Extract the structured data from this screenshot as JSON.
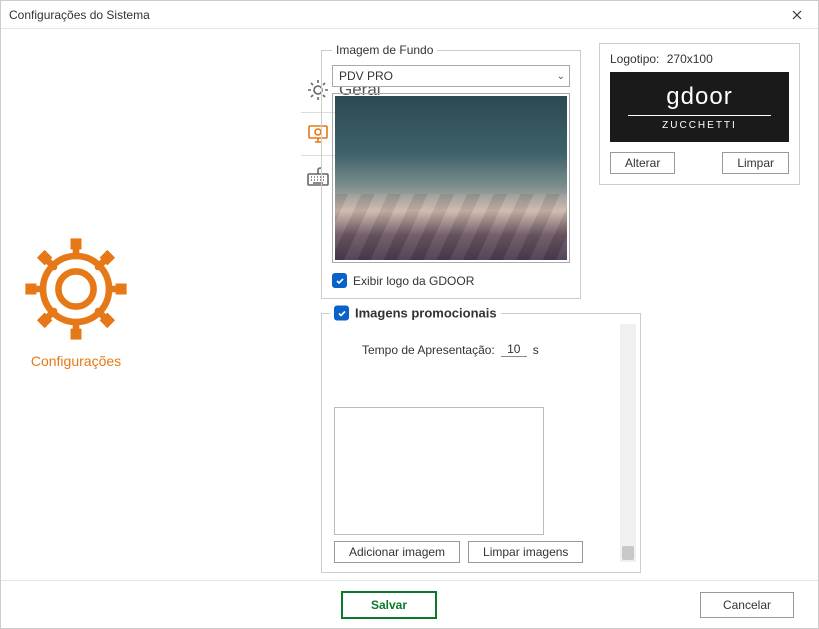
{
  "window": {
    "title": "Configurações do Sistema"
  },
  "sidebar": {
    "brand_label": "Configurações",
    "items": [
      {
        "label": "Geral"
      },
      {
        "label": "Aparência"
      },
      {
        "label": "Periféricos"
      }
    ]
  },
  "background_image": {
    "legend": "Imagem de Fundo",
    "select_value": "PDV PRO",
    "show_logo_label": "Exibir logo da GDOOR",
    "show_logo_checked": true
  },
  "logo": {
    "label": "Logotipo:",
    "dims": "270x100",
    "brand_main": "gdoor",
    "brand_sub": "ZUCCHETTI",
    "btn_alter": "Alterar",
    "btn_clear": "Limpar"
  },
  "promo": {
    "title": "Imagens promocionais",
    "checked": true,
    "time_label": "Tempo de Apresentação:",
    "time_value": "10",
    "time_unit": "s",
    "btn_add": "Adicionar imagem",
    "btn_clear": "Limpar imagens"
  },
  "footer": {
    "save": "Salvar",
    "cancel": "Cancelar"
  }
}
